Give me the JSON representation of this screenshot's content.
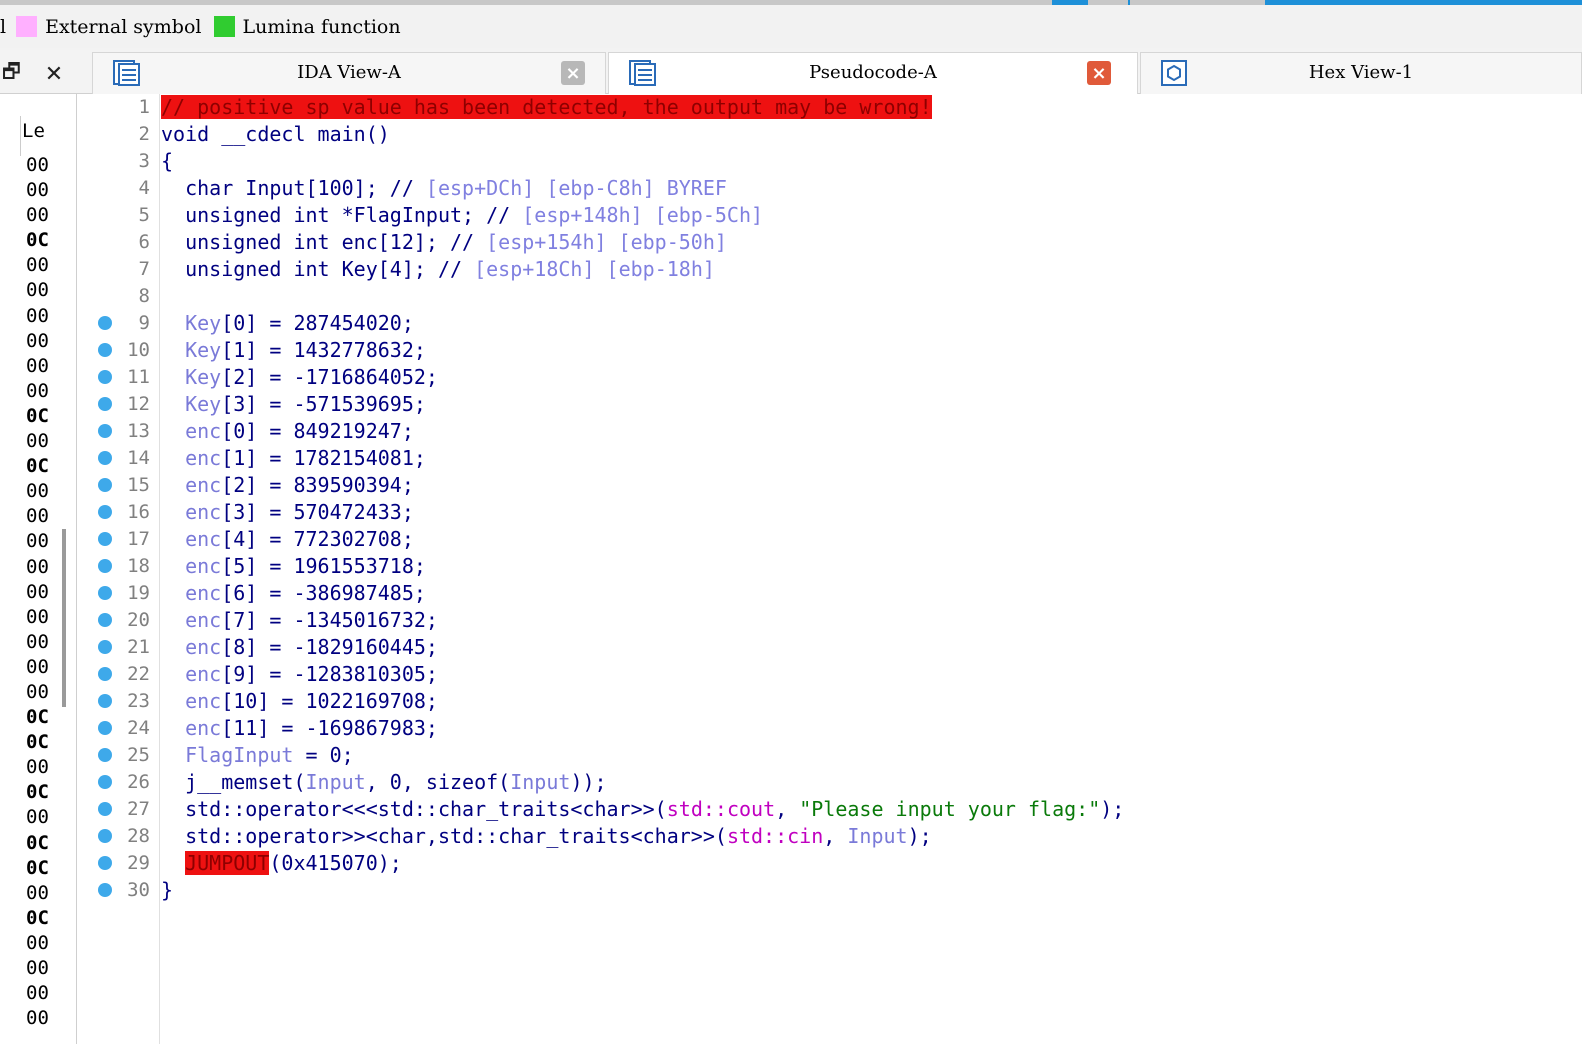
{
  "legend": [
    {
      "label": "External symbol",
      "color": "#ffb0ff"
    },
    {
      "label": "Lumina function",
      "color": "#30cc30"
    }
  ],
  "legend_prefix": "l",
  "tabs": [
    {
      "label": "IDA View-A",
      "close_color": "#b8b8b8",
      "active": false
    },
    {
      "label": "Pseudocode-A",
      "close_color": "#e05a3a",
      "active": true
    },
    {
      "label": "Hex View-1",
      "active": false
    }
  ],
  "left_panel": {
    "header": "Le",
    "values": [
      "00",
      "00",
      "00",
      "0C",
      "00",
      "00",
      "00",
      "00",
      "00",
      "00",
      "0C",
      "00",
      "0C",
      "00",
      "00",
      "00",
      "00",
      "00",
      "00",
      "00",
      "00",
      "00",
      "0C",
      "0C",
      "00",
      "0C",
      "00",
      "0C",
      "0C",
      "00",
      "0C",
      "00",
      "00",
      "00",
      "00"
    ],
    "bold_indices": [
      3,
      10,
      12,
      22,
      23,
      25,
      27,
      28,
      30
    ]
  },
  "code": {
    "error_line": "// positive sp value has been detected, the output may be wrong!",
    "signature": "void __cdecl main()",
    "open_brace": "{",
    "decls": [
      {
        "text": "char Input[100]; // ",
        "comment": "[esp+DCh] [ebp-C8h] BYREF"
      },
      {
        "text": "unsigned int *FlagInput; // ",
        "comment": "[esp+148h] [ebp-5Ch]"
      },
      {
        "text": "unsigned int enc[12]; // ",
        "comment": "[esp+154h] [ebp-50h]"
      },
      {
        "text": "unsigned int Key[4]; // ",
        "comment": "[esp+18Ch] [ebp-18h]"
      }
    ],
    "assigns": [
      {
        "var": "Key",
        "idx": "[0]",
        "rhs": " = 287454020;"
      },
      {
        "var": "Key",
        "idx": "[1]",
        "rhs": " = 1432778632;"
      },
      {
        "var": "Key",
        "idx": "[2]",
        "rhs": " = -1716864052;"
      },
      {
        "var": "Key",
        "idx": "[3]",
        "rhs": " = -571539695;"
      },
      {
        "var": "enc",
        "idx": "[0]",
        "rhs": " = 849219247;"
      },
      {
        "var": "enc",
        "idx": "[1]",
        "rhs": " = 1782154081;"
      },
      {
        "var": "enc",
        "idx": "[2]",
        "rhs": " = 839590394;"
      },
      {
        "var": "enc",
        "idx": "[3]",
        "rhs": " = 570472433;"
      },
      {
        "var": "enc",
        "idx": "[4]",
        "rhs": " = 772302708;"
      },
      {
        "var": "enc",
        "idx": "[5]",
        "rhs": " = 1961553718;"
      },
      {
        "var": "enc",
        "idx": "[6]",
        "rhs": " = -386987485;"
      },
      {
        "var": "enc",
        "idx": "[7]",
        "rhs": " = -1345016732;"
      },
      {
        "var": "enc",
        "idx": "[8]",
        "rhs": " = -1829160445;"
      },
      {
        "var": "enc",
        "idx": "[9]",
        "rhs": " = -1283810305;"
      },
      {
        "var": "enc",
        "idx": "[10]",
        "rhs": " = 1022169708;"
      },
      {
        "var": "enc",
        "idx": "[11]",
        "rhs": " = -169867983;"
      },
      {
        "var": "FlagInput",
        "idx": "",
        "rhs": " = 0;"
      }
    ],
    "memset": {
      "fn": "j__memset(",
      "a1": "Input",
      "mid": ", 0, sizeof(",
      "a2": "Input",
      "end": "));"
    },
    "cout": {
      "fn": "std::operator<<<std::char_traits<char>>(",
      "obj": "std::cout",
      "sep": ", ",
      "str": "\"Please input your flag:\"",
      "end": ");"
    },
    "cin": {
      "fn": "std::operator>><char,std::char_traits<char>>(",
      "obj": "std::cin",
      "sep": ", ",
      "arg": "Input",
      "end": ");"
    },
    "jump": {
      "fn": "JUMPOUT",
      "rest": "(0x415070);"
    },
    "close_brace": "}",
    "line_count": 30,
    "dot_from": 9
  }
}
